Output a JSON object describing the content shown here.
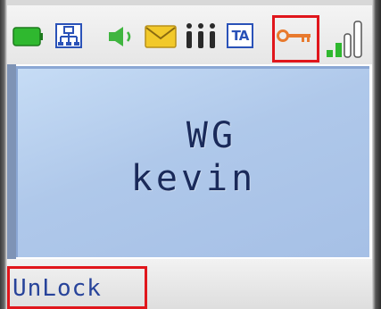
{
  "screen": {
    "line1": "WG",
    "line2": "kevin"
  },
  "softkeys": {
    "left_label": "UnLock"
  },
  "status_bar": {
    "icons": [
      "battery-icon",
      "network-icon",
      "speaker-icon",
      "message-icon",
      "lines-icon",
      "ta-icon",
      "key-lock-icon",
      "signal-strength-icon"
    ],
    "ta_label": "TA",
    "signal_level_fraction": 0.5
  },
  "annotations": {
    "highlight_color": "#e0161c"
  },
  "colors": {
    "display_bg": "#afc8ea",
    "text": "#1a2a5a",
    "softkey_text": "#27439a",
    "battery": "#2fb82f",
    "key": "#e87a2e"
  }
}
